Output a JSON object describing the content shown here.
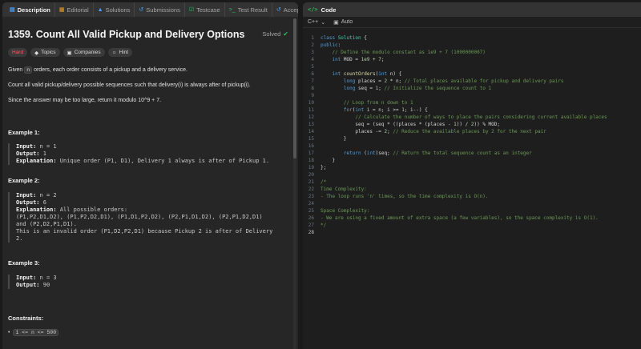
{
  "tabs": [
    {
      "label": "Description",
      "icon": "document-icon",
      "active": true
    },
    {
      "label": "Editorial",
      "icon": "book-icon"
    },
    {
      "label": "Solutions",
      "icon": "flask-icon"
    },
    {
      "label": "Submissions",
      "icon": "history-icon"
    },
    {
      "label": "Testcase",
      "icon": "checkbox-icon"
    },
    {
      "label": "Test Result",
      "icon": "terminal-icon"
    },
    {
      "label": "Accepted",
      "icon": "accepted-icon"
    }
  ],
  "problem": {
    "title": "1359. Count All Valid Pickup and Delivery Options",
    "status": "Solved",
    "difficulty": "Hard",
    "topics_label": "Topics",
    "companies_label": "Companies",
    "hint_label": "Hint",
    "desc1_a": "Given ",
    "desc1_code": "n",
    "desc1_b": " orders, each order consists of a pickup and a delivery service.",
    "desc2": "Count all valid pickup/delivery possible sequences such that delivery(i) is always after of pickup(i).",
    "desc3": "Since the answer may be too large, return it modulo 10^9 + 7."
  },
  "examples": [
    {
      "heading": "Example 1:",
      "lines": [
        "Input: n = 1",
        "Output: 1",
        "Explanation: Unique order (P1, D1), Delivery 1 always is after of Pickup 1."
      ]
    },
    {
      "heading": "Example 2:",
      "lines": [
        "Input: n = 2",
        "Output: 6",
        "Explanation: All possible orders:",
        "(P1,P2,D1,D2), (P1,P2,D2,D1), (P1,D1,P2,D2), (P2,P1,D1,D2), (P2,P1,D2,D1)",
        "and (P2,D2,P1,D1).",
        "This is an invalid order (P1,D2,P2,D1) because Pickup 2 is after of Delivery",
        "2."
      ]
    },
    {
      "heading": "Example 3:",
      "lines": [
        "Input: n = 3",
        "Output: 90"
      ]
    }
  ],
  "constraints": {
    "heading": "Constraints:",
    "items": [
      "1 <= n <= 500"
    ]
  },
  "editor": {
    "title": "Code",
    "language": "C++",
    "mode": "Auto",
    "lines": [
      "class Solution {",
      "public:",
      "    // Define the modulo constant as 1e9 + 7 (1000000007)",
      "    int MOD = 1e9 + 7;",
      "",
      "    int countOrders(int n) {",
      "        long places = 2 * n; // Total places available for pickup and delivery pairs",
      "        long seq = 1; // Initialize the sequence count to 1",
      "",
      "        // Loop from n down to 1",
      "        for(int i = n; i >= 1; i--) {",
      "            // Calculate the number of ways to place the pairs considering current available places",
      "            seq = (seq * ((places * (places - 1)) / 2)) % MOD;",
      "            places -= 2; // Reduce the available places by 2 for the next pair",
      "        }",
      "",
      "        return (int)seq; // Return the total sequence count as an integer",
      "    }",
      "};",
      "",
      "/*",
      "Time Complexity:",
      "- The loop runs 'n' times, so the time complexity is O(n).",
      "",
      "Space Complexity:",
      "- We are using a fixed amount of extra space (a few variables), so the space complexity is O(1).",
      "*/",
      ""
    ]
  }
}
